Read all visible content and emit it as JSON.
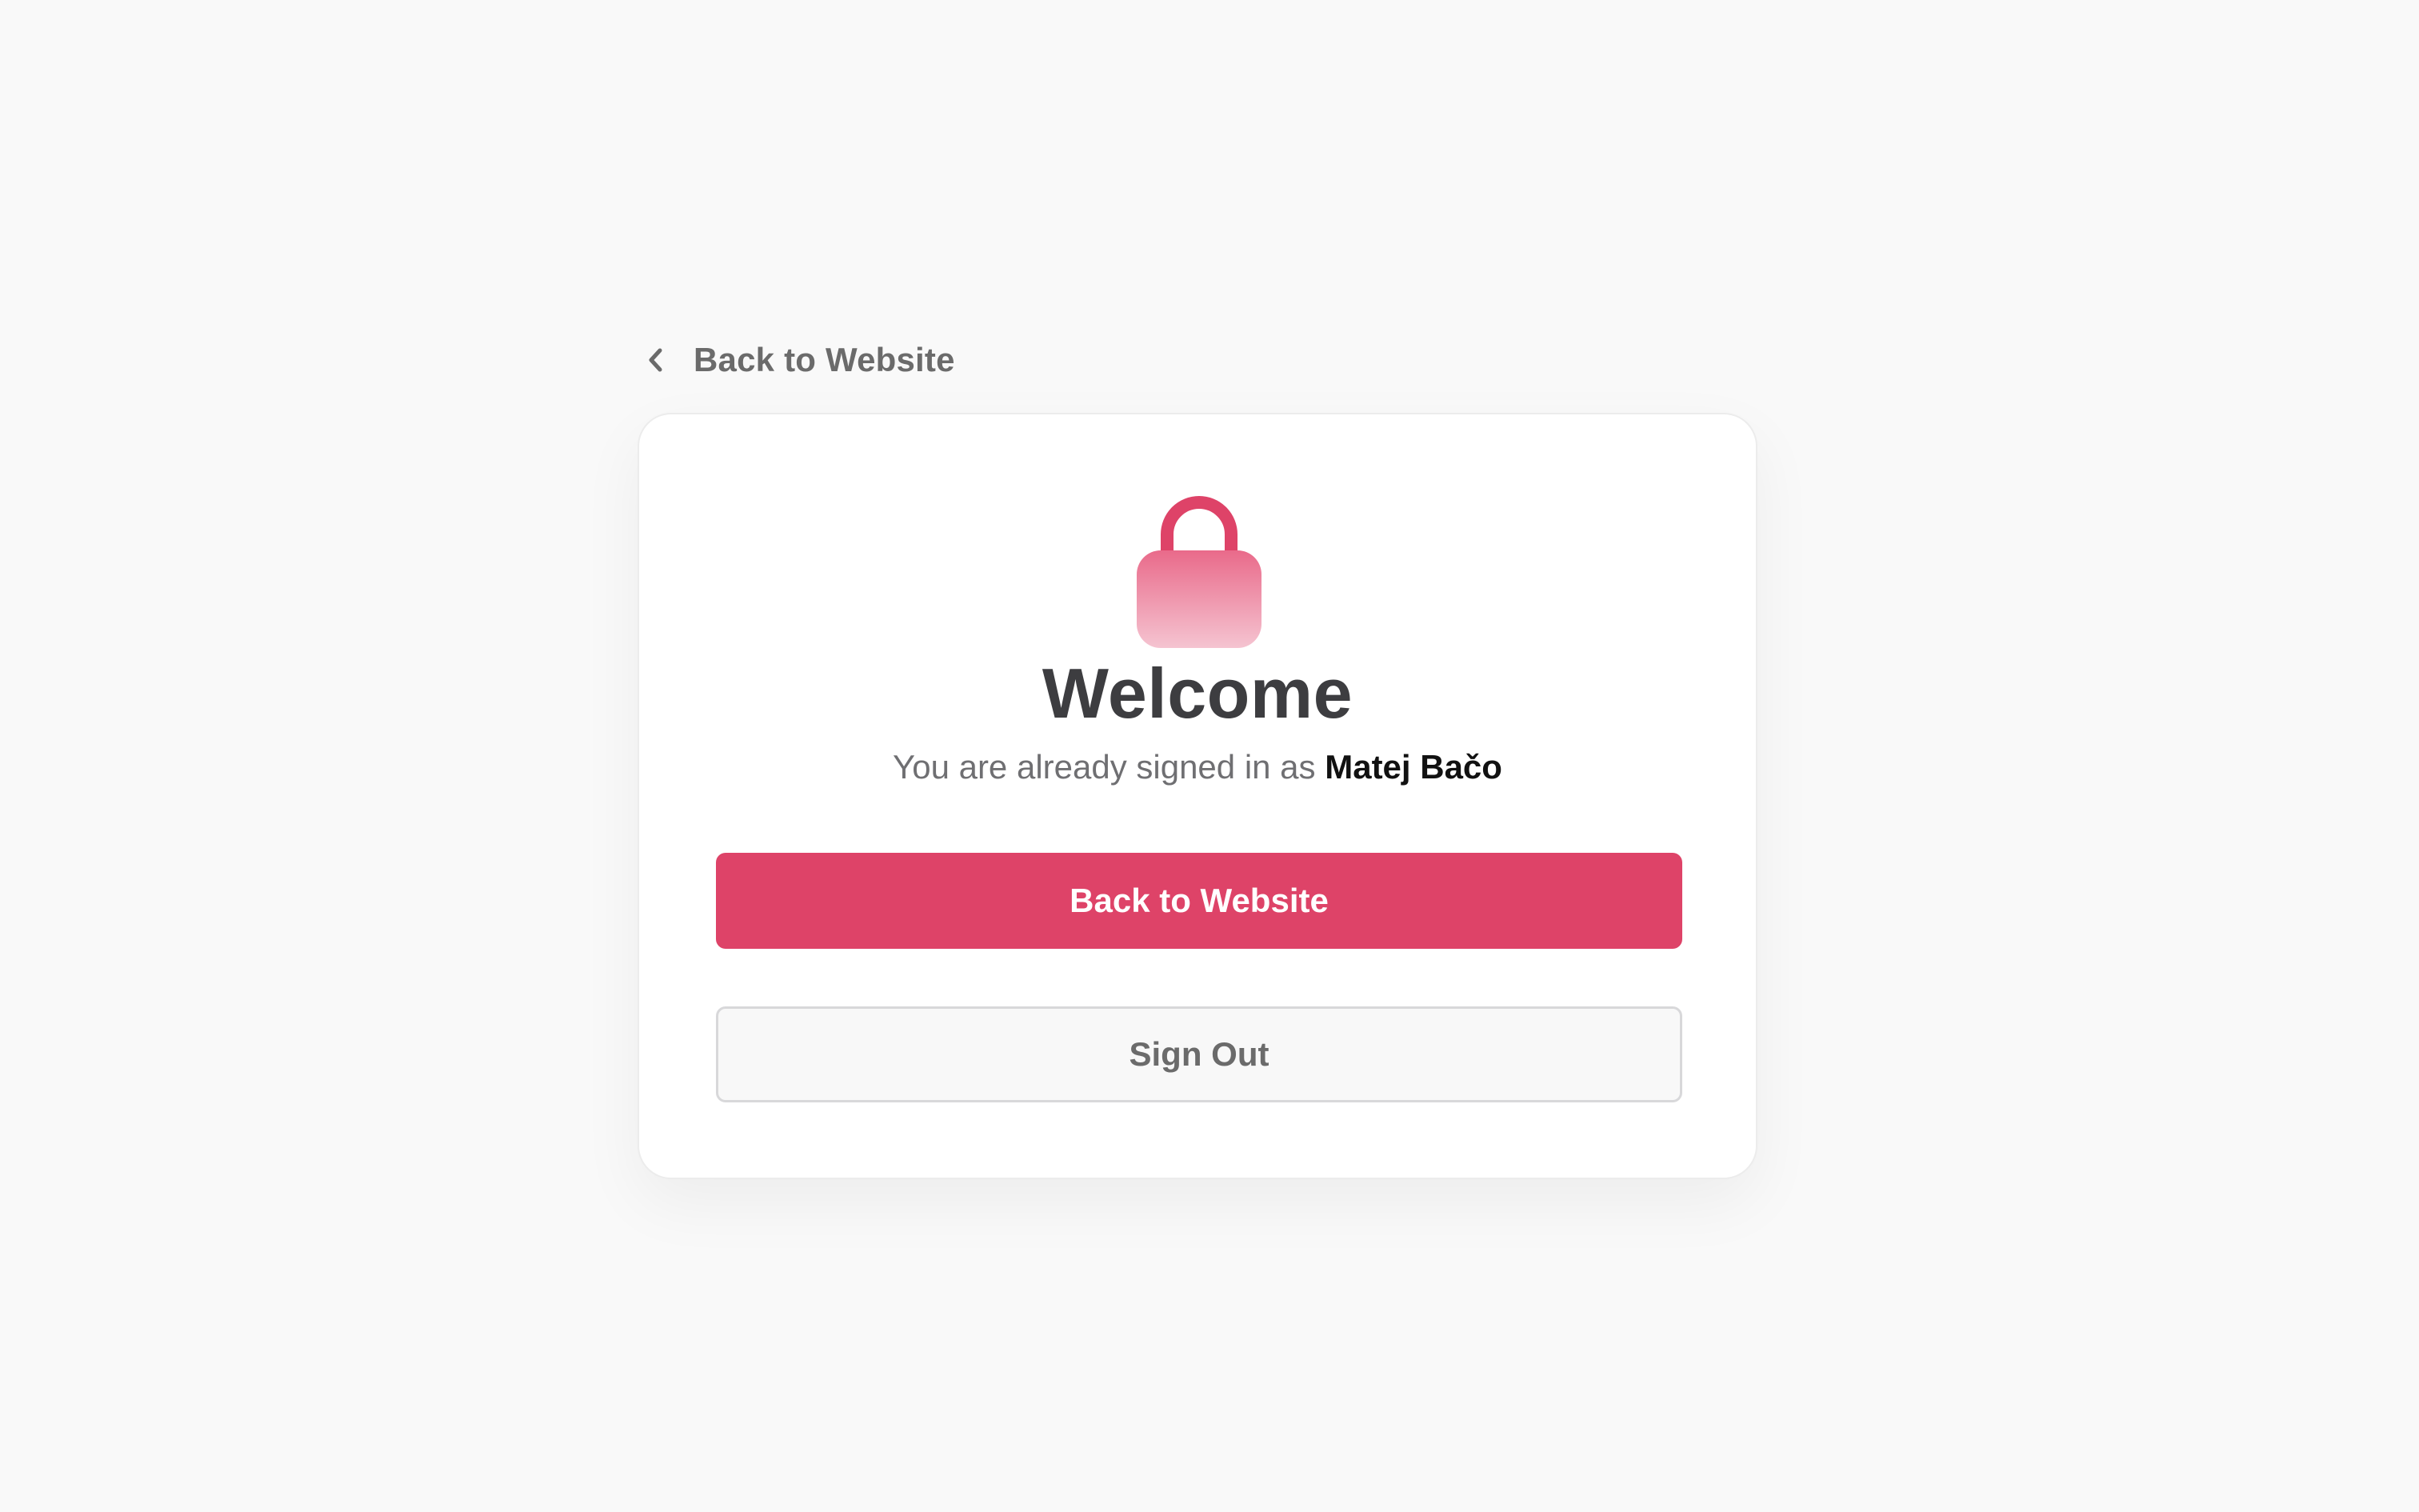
{
  "header": {
    "back_link_label": "Back to Website"
  },
  "card": {
    "icon": "lock-icon",
    "title": "Welcome",
    "subtitle_prefix": "You are already signed in as",
    "user_name": "Matej Bačo",
    "primary_button_label": "Back to Website",
    "secondary_button_label": "Sign Out"
  },
  "colors": {
    "accent": "#de4368",
    "background": "#f9f9f9",
    "card": "#ffffff",
    "title": "#3d3d40",
    "muted_text": "#6f6f72"
  }
}
